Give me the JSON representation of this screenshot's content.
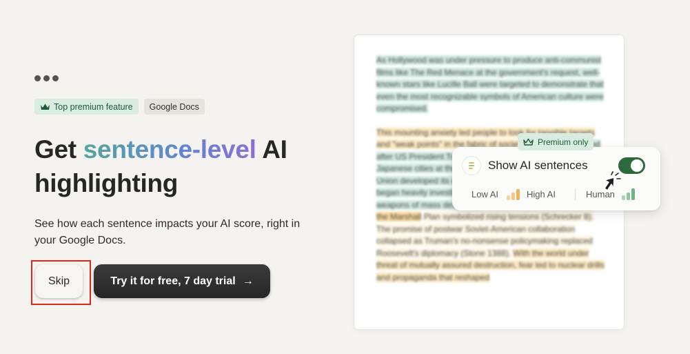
{
  "badges": {
    "premium_feature": "Top premium feature",
    "docs": "Google Docs"
  },
  "headline": {
    "prefix": "Get ",
    "highlight": "sentence-level",
    "suffix": " AI highlighting"
  },
  "subtitle": "See how each sentence impacts your AI score, right in your Google Docs.",
  "buttons": {
    "skip": "Skip",
    "trial": "Try it for free, 7 day trial",
    "trial_arrow": "→"
  },
  "doc_preview": {
    "paragraph1": "As Hollywood was under pressure to produce anti-communist films like The Red Menace at the government's request, well-known stars like Lucille Ball were targeted to demonstrate that even the most recognizable symbols of American culture were compromised.",
    "p2_a": "This mounting anxiety led people to look for tangible targets and \"weak points\" in the fabric of society.",
    "p2_b": "Cold War escalated after US President Truman ordered atomic bombs on two Japanese cities at the end of World War II. As the Soviet Union developed its own weapons arsenal, the United States began heavily investing in the development of its own weapons of mass destruction.",
    "p2_c": "The Soviet refusal of aid from the Marshall",
    "p2_d": "Plan symbolized rising tensions (Schrecker 8). The promise of postwar Soviet-American collaboration collapsed as Truman's no-nonsense policymaking replaced Roosevelt's diplomacy (Stone 1388).",
    "p2_e": "With the world under threat of mutually assured destruction, fear led to nuclear drills and propaganda that reshaped"
  },
  "ai_card": {
    "badge": "Premium only",
    "title": "Show AI sentences",
    "toggle_on": true,
    "legend_low": "Low AI",
    "legend_high": "High AI",
    "legend_human": "Human"
  },
  "colors": {
    "background": "#f4f3ef",
    "premium_green": "#1e5a36",
    "toggle_green": "#2d6b3f",
    "highlight_green": "#cfe9df",
    "highlight_yellow": "#fbe8bf",
    "skip_outline": "#e0261c"
  },
  "icons": [
    "more-dots-icon",
    "crown-icon",
    "docs-icon",
    "toggle-switch",
    "pointer-cursor-icon",
    "signal-bars-icon",
    "arrow-right-icon"
  ]
}
